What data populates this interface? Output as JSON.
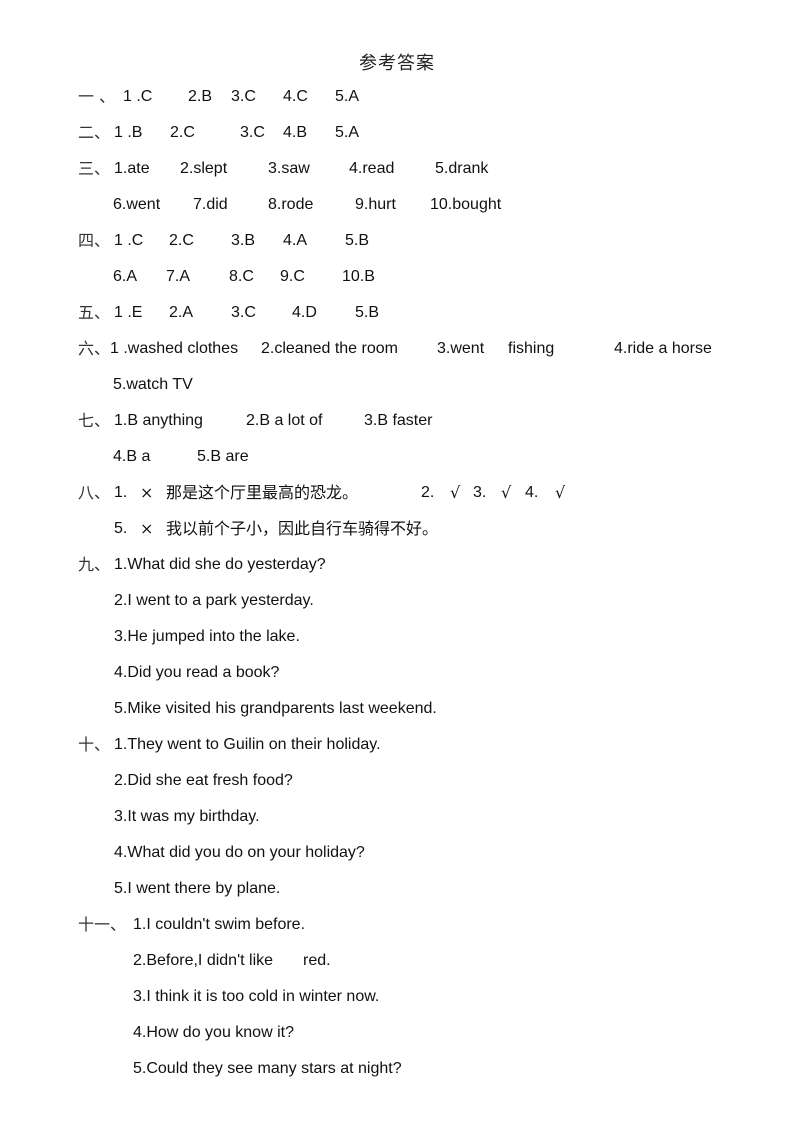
{
  "title": "参考答案",
  "sections": {
    "s1": {
      "num": "一 、",
      "items": [
        "1 .C",
        "2.B",
        "3.C",
        "4.C",
        "5.A"
      ]
    },
    "s2": {
      "num": "二、",
      "items": [
        "1 .B",
        "2.C",
        "3.C",
        "4.B",
        "5.A"
      ]
    },
    "s3": {
      "num": "三、",
      "items": [
        "1.ate",
        "2.slept",
        "3.saw",
        "4.read",
        "5.drank",
        "6.went",
        "7.did",
        "8.rode",
        "9.hurt",
        "10.bought"
      ]
    },
    "s4": {
      "num": "四、",
      "items": [
        "1 .C",
        "2.C",
        "3.B",
        "4.A",
        "5.B",
        "6.A",
        "7.A",
        "8.C",
        "9.C",
        "10.B"
      ]
    },
    "s5": {
      "num": "五、",
      "items": [
        "1 .E",
        "2.A",
        "3.C",
        "4.D",
        "5.B"
      ]
    },
    "s6": {
      "num": "六、",
      "items": [
        "1 .washed clothes",
        "2.cleaned the room",
        "3.went",
        "fishing",
        "4.ride a horse",
        "5.watch TV"
      ]
    },
    "s7": {
      "num": "七、",
      "items": [
        "1.B anything",
        "2.B a lot of",
        "3.B faster",
        "4.B a",
        "5.B are"
      ]
    },
    "s8": {
      "num": "八、",
      "items": [
        "1.",
        "×",
        "那是这个厅里最高的恐龙。",
        "2.",
        "√",
        "3.",
        "√",
        "4.",
        "√",
        "5.",
        "×",
        "我以前个子小，因此自行车骑得不好。"
      ]
    },
    "s9": {
      "num": "九、",
      "items": [
        "1.What did she do yesterday?",
        "2.I went to a park yesterday.",
        "3.He jumped into the lake.",
        "4.Did you read a book?",
        "5.Mike visited his grandparents last weekend."
      ]
    },
    "s10": {
      "num": "十、",
      "items": [
        "1.They went to Guilin on their holiday.",
        "2.Did she eat fresh food?",
        "3.It was my birthday.",
        "4.What did you do on your holiday?",
        "5.I went there by plane."
      ]
    },
    "s11": {
      "num": "十一、",
      "items": [
        "1.I couldn't swim before.",
        "2.Before,I didn't like",
        "red.",
        "3.I think it is too cold in winter now.",
        "4.How do you know it?",
        "5.Could they see many stars at night?"
      ]
    }
  }
}
